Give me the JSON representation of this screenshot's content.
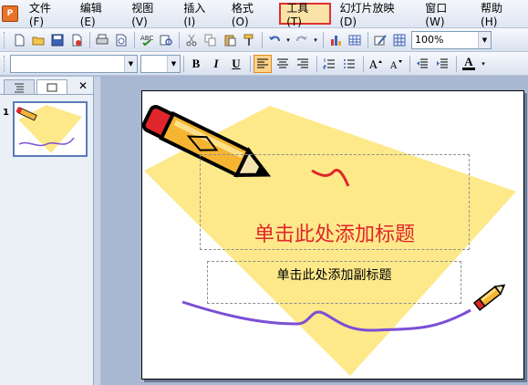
{
  "app": {
    "icon_label": "P"
  },
  "menu": [
    {
      "label": "文件(F)"
    },
    {
      "label": "编辑(E)"
    },
    {
      "label": "视图(V)"
    },
    {
      "label": "插入(I)"
    },
    {
      "label": "格式(O)"
    },
    {
      "label": "工具(T)",
      "highlighted": true
    },
    {
      "label": "幻灯片放映(D)"
    },
    {
      "label": "窗口(W)"
    },
    {
      "label": "帮助(H)"
    }
  ],
  "toolbar": {
    "zoom_value": "100%"
  },
  "format_toolbar": {
    "font_name": "",
    "font_size": "",
    "bold": "B",
    "italic": "I",
    "underline": "U",
    "font_color": "A"
  },
  "sidebar": {
    "tab_close": "✕",
    "slide_number": "1"
  },
  "slide": {
    "title_placeholder": "单击此处添加标题",
    "subtitle_placeholder": "单击此处添加副标题"
  },
  "colors": {
    "highlight_border": "#e03030",
    "title_text": "#e0262b",
    "diamond": "#fde98a",
    "wave": "#7b4fd6"
  }
}
